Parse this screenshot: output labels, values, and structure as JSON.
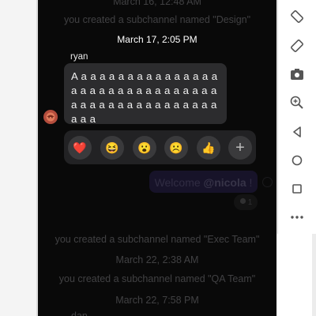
{
  "messages": {
    "top_system": "you created a subchannel named \"Design\"",
    "top_date_partial": "March 16, 12:48 AM",
    "focused": {
      "timestamp": "March 17, 2:05 PM",
      "author": "ryan",
      "lines": [
        "A a a a a a a a a a a a a a a a a a",
        "a a a a a a a a a a a a a a a a a a",
        "a a a a a a a a a a a a a a a a a a",
        "a a a"
      ]
    },
    "welcome": {
      "prefix": "Welcome ",
      "mention": "@nicola",
      "suffix": " !"
    },
    "reply_count": "1",
    "system_exec": "you created a subchannel named \"Exec Team\"",
    "date_mar22_a": "March 22, 2:38 AM",
    "system_qa": "you created a subchannel named \"QA Team\"",
    "date_mar22_b": "March 22, 7:58 PM",
    "author_dan": "dan"
  },
  "reactions": [
    {
      "name": "heart",
      "glyph": "❤️"
    },
    {
      "name": "laughing",
      "glyph": "😆"
    },
    {
      "name": "surprised",
      "glyph": "😮"
    },
    {
      "name": "sad",
      "glyph": "☹️"
    },
    {
      "name": "thumbs-up",
      "glyph": "👍"
    },
    {
      "name": "add-reaction",
      "glyph": "+"
    }
  ],
  "toolbar": [
    "rotate-left",
    "rotate-right",
    "camera",
    "zoom-in",
    "back",
    "home",
    "overview",
    "more"
  ],
  "colors": {
    "welcome_bubble": "#332a5c",
    "avatar": "#b44d3d",
    "toolbar_icon": "#555555"
  }
}
